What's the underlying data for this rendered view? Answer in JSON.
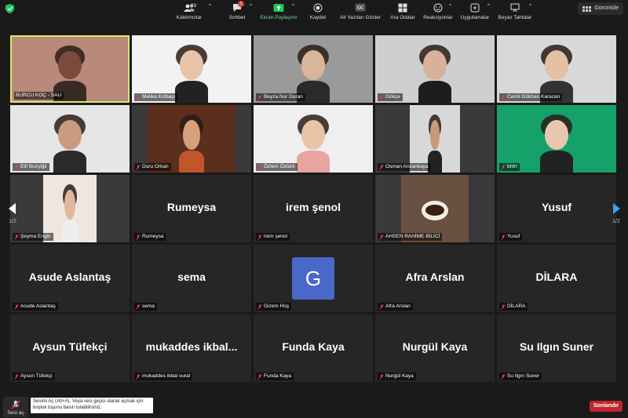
{
  "header": {
    "view_label": "Görüntüle"
  },
  "pager": {
    "left": "1/2",
    "right": "1/2"
  },
  "participants": [
    {
      "name": "BURCU KOÇ - SAU",
      "video": true,
      "active": true,
      "muted": false
    },
    {
      "name": "Melika Kolbaşı",
      "video": true,
      "muted": true
    },
    {
      "name": "Beyza Nur Duran",
      "video": true,
      "muted": true
    },
    {
      "name": "Gökçe",
      "video": true,
      "muted": true
    },
    {
      "name": "Cemil Gökhan Karacan",
      "video": true,
      "muted": true
    },
    {
      "name": "Elif Bozyiğit",
      "video": true,
      "muted": true
    },
    {
      "name": "Duru Orkan",
      "video": true,
      "muted": true
    },
    {
      "name": "Özlem Öztürk",
      "video": true,
      "muted": true
    },
    {
      "name": "Osman Arslankaya",
      "video": true,
      "muted": true
    },
    {
      "name": "bhfrr",
      "video": true,
      "muted": true
    },
    {
      "name": "Şeyma Engin",
      "video": true,
      "muted": true
    },
    {
      "name": "Rumeysa",
      "display": "Rumeysa",
      "video": false,
      "muted": true
    },
    {
      "name": "irem şenol",
      "display": "irem şenol",
      "video": false,
      "muted": true
    },
    {
      "name": "AHSEN RAHİME BİLİCİ",
      "video": true,
      "muted": true
    },
    {
      "name": "Yusuf",
      "display": "Yusuf",
      "video": false,
      "muted": true
    },
    {
      "name": "Asude Aslantaş",
      "display": "Asude Aslantaş",
      "video": false,
      "muted": true
    },
    {
      "name": "sema",
      "display": "sema",
      "video": false,
      "muted": true
    },
    {
      "name": "Gizem Hoş",
      "avatar": "G",
      "video": false,
      "muted": true
    },
    {
      "name": "Afra Arslan",
      "display": "Afra Arslan",
      "video": false,
      "muted": true
    },
    {
      "name": "DİLARA",
      "display": "DİLARA",
      "video": false,
      "muted": true
    },
    {
      "name": "Aysun Tüfekçi",
      "display": "Aysun Tüfekçi",
      "video": false,
      "muted": true
    },
    {
      "name": "mukaddes ikbal vural",
      "display": "mukaddes  ikbal...",
      "video": false,
      "muted": true
    },
    {
      "name": "Funda Kaya",
      "display": "Funda Kaya",
      "video": false,
      "muted": true
    },
    {
      "name": "Nurgül Kaya",
      "display": "Nurgül Kaya",
      "video": false,
      "muted": true
    },
    {
      "name": "Su Ilgın Suner",
      "display": "Su Ilgın Suner",
      "video": false,
      "muted": true
    }
  ],
  "toolbar": {
    "mute_label": "Sesi aç",
    "tooltip": "Sesimi Aç (Alt+A). Veya sesi geçici olarak açmak için boşluk tuşunu basılı tutabilirsiniz.",
    "participants_label": "Katılımcılar",
    "participants_count": "29",
    "chat_label": "Sohbet",
    "chat_badge": "1",
    "share_label": "Ekran Paylaşımı",
    "record_label": "Kaydet",
    "cc_label": "Alt Yazıları Göster",
    "breakout_label": "Ara Odalar",
    "reactions_label": "Reaksiyonlar",
    "apps_label": "Uygulamalar",
    "whiteboard_label": "Beyaz Tahtalar",
    "end_label": "Sonlandır"
  },
  "colors": {
    "active_border": "#d8ea6b",
    "share_green": "#22c55e",
    "end_red": "#c0262d",
    "avatar_blue": "#4a68c8",
    "mute_red": "#e04040"
  }
}
